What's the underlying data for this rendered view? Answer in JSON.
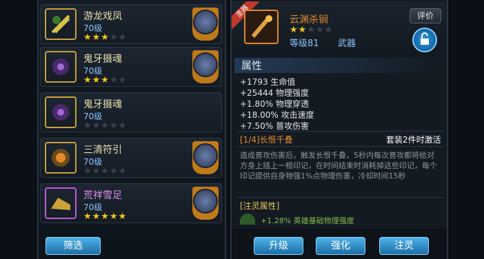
{
  "items": [
    {
      "name": "游龙戏凤",
      "level": "70级",
      "stars": 3,
      "rarity": "gold"
    },
    {
      "name": "鬼牙摄魂",
      "level": "70级",
      "stars": 3,
      "rarity": "gold"
    },
    {
      "name": "鬼牙摄魂",
      "level": "70级",
      "stars": 0,
      "rarity": "gold"
    },
    {
      "name": "三清符引",
      "level": "70级",
      "stars": 0,
      "rarity": "gold"
    },
    {
      "name": "荒祥雪足",
      "level": "70级",
      "stars": 5,
      "rarity": "purple"
    }
  ],
  "filter_label": "筛选",
  "detail": {
    "rank_label": "圣器",
    "name": "云渊杀锏",
    "stars": 2,
    "level": "等级81",
    "type": "武器",
    "review_label": "评价",
    "section_title": "属性",
    "attributes": [
      "+1793 生命值",
      "+25444 物理强度",
      "+1.80% 物理穿透",
      "+18.00% 攻击速度",
      "+7.50% 普攻伤害"
    ],
    "set_title": "[1/4]长恨千叠",
    "set_status": "套装2件时激活",
    "set_desc": "造成普攻伤害后，触发长恨千叠，5秒内每次普攻都将给对方身上插上一根印记，在时间结束时消耗掉这些印记，每个印记提供自身物强1%点物理伤害，冷却时间15秒",
    "infuse_title": "[注灵属性]",
    "infuse_line": "+1.28% 英雄基础物理强度"
  },
  "actions": [
    "升级",
    "强化",
    "注灵"
  ]
}
